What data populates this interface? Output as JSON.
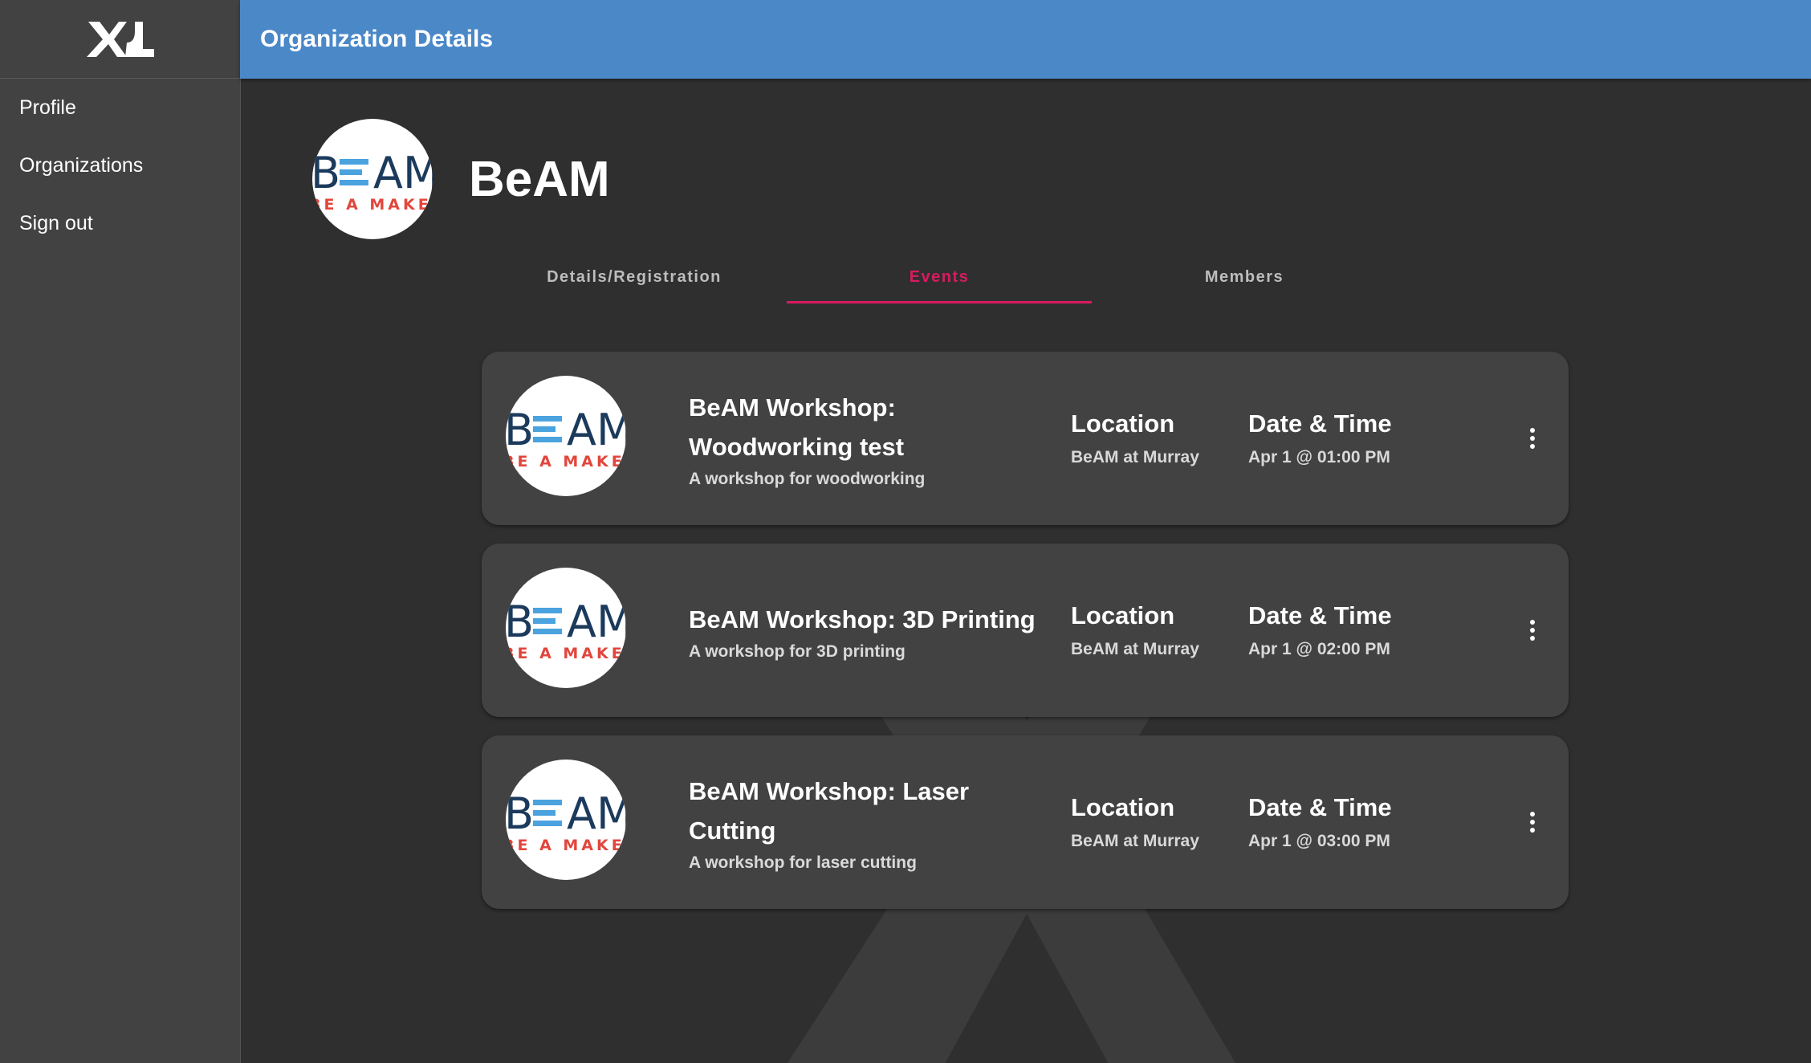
{
  "app": {
    "logo_text": "XL",
    "header_title": "Organization Details"
  },
  "sidebar": {
    "items": [
      {
        "label": "Profile"
      },
      {
        "label": "Organizations"
      },
      {
        "label": "Sign out"
      }
    ]
  },
  "organization": {
    "name": "BeAM",
    "logo_text_top": "BEAM",
    "logo_text_bottom": "BE A MAKER"
  },
  "tabs": [
    {
      "label": "Details/Registration",
      "active": false
    },
    {
      "label": "Events",
      "active": true
    },
    {
      "label": "Members",
      "active": false
    }
  ],
  "events": [
    {
      "title": "BeAM Workshop: Woodworking test",
      "description": "A workshop for woodworking",
      "location_label": "Location",
      "location": "BeAM at Murray",
      "datetime_label": "Date & Time",
      "datetime": "Apr 1 @ 01:00 PM"
    },
    {
      "title": "BeAM Workshop: 3D Printing",
      "description": "A workshop for 3D printing",
      "location_label": "Location",
      "location": "BeAM at Murray",
      "datetime_label": "Date & Time",
      "datetime": "Apr 1 @ 02:00 PM"
    },
    {
      "title": "BeAM Workshop: Laser Cutting",
      "description": "A workshop for laser cutting",
      "location_label": "Location",
      "location": "BeAM at Murray",
      "datetime_label": "Date & Time",
      "datetime": "Apr 1 @ 03:00 PM"
    }
  ],
  "colors": {
    "header_blue": "#4a88c8",
    "active_tab": "#d81b60",
    "background": "#2f2f2f",
    "sidebar": "#424242",
    "card": "#424242",
    "beam_blue": "#1b3a5c",
    "beam_light_blue": "#4aa3df",
    "beam_red": "#e2463c"
  }
}
